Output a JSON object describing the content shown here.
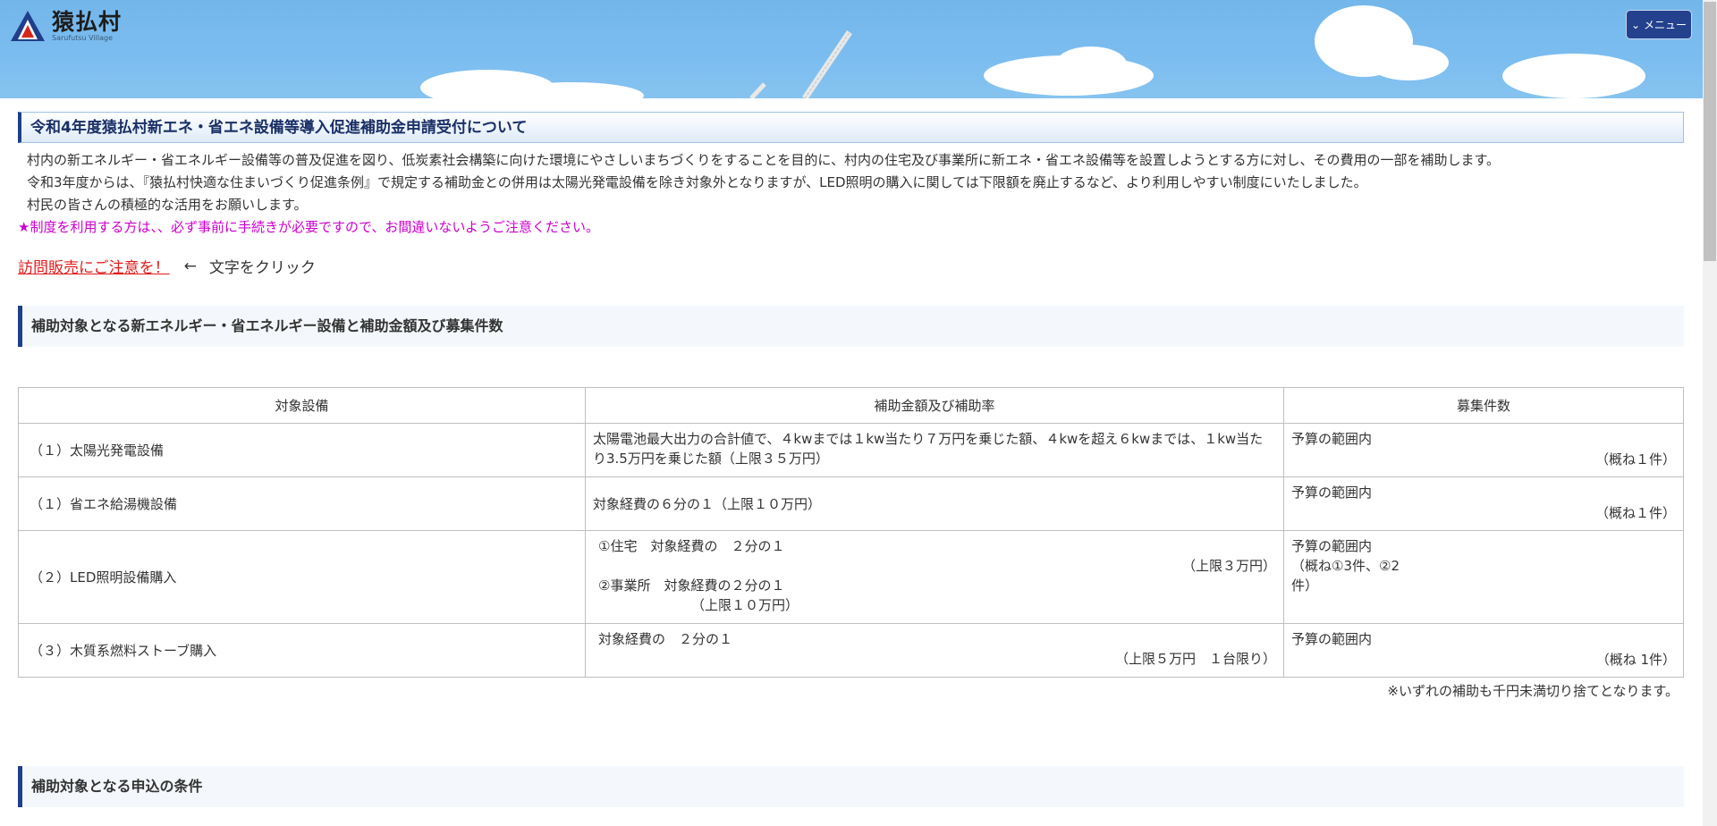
{
  "header": {
    "logo_title": "猿払村",
    "logo_sub": "Sarufutsu Village",
    "menu_label": "メニュー"
  },
  "page": {
    "title": "令和4年度猿払村新エネ・省エネ設備等導入促進補助金申請受付について",
    "intro": [
      "村内の新エネルギー・省エネルギー設備等の普及促進を図り、低炭素社会構築に向けた環境にやさしいまちづくりをすることを目的に、村内の住宅及び事業所に新エネ・省エネ設備等を設置しようとする方に対し、その費用の一部を補助します。",
      "令和3年度からは、『猿払村快適な住まいづくり促進条例』で規定する補助金との併用は太陽光発電設備を除き対象外となりますが、LED照明の購入に関しては下限額を廃止するなど、より利用しやすい制度にいたしました。",
      "村民の皆さんの積極的な活用をお願いします。"
    ],
    "notice": "★制度を利用する方は、、必ず事前に手続きが必要ですので、お間違いないようご注意ください。",
    "visit_link": "訪問販売にご注意を！",
    "arrow": "←",
    "click_hint": "文字をクリック"
  },
  "section1": {
    "heading": "補助対象となる新エネルギー・省エネルギー設備と補助金額及び募集件数"
  },
  "table": {
    "headers": [
      "対象設備",
      "補助金額及び補助率",
      "募集件数"
    ],
    "rows": [
      {
        "item": "（１）太陽光発電設備",
        "amount_lines": [
          "太陽電池最大出力の合計値で、４kwまでは１kw当たり７万円を乗じた額、４kwを超え６kwまでは、１kw当たり3.5万円を乗じた額（上限３５万円）"
        ],
        "recruit": "予算の範囲内",
        "recruit_count": "（概ね１件）"
      },
      {
        "item": "（１）省エネ給湯機設備",
        "amount_lines": [
          "対象経費の６分の１（上限１０万円）"
        ],
        "recruit": "予算の範囲内",
        "recruit_count": "（概ね１件）"
      },
      {
        "item": "（２）LED照明設備購入",
        "amount_a": "①住宅　対象経費の　２分の１",
        "amount_a_limit": "（上限３万円）",
        "amount_b": "②事業所　対象経費の２分の１",
        "amount_b_limit": "（上限１０万円）",
        "recruit": "予算の範囲内",
        "recruit_count_a": "（概ね①3件、②2",
        "recruit_count_b": "件）"
      },
      {
        "item": "（３）木質系燃料ストーブ購入",
        "amount_a": "対象経費の　２分の１",
        "amount_a_limit": "（上限５万円　１台限り）",
        "recruit": "予算の範囲内",
        "recruit_count": "（概ね 1件）"
      }
    ],
    "note": "※いずれの補助も千円未満切り捨てとなります。"
  },
  "section2": {
    "heading": "補助対象となる申込の条件"
  },
  "colors": {
    "header_sky": "#7cbdf0",
    "accent_navy": "#1f3f8a",
    "notice_magenta": "#cc00cc",
    "link_red": "#e01b1b"
  }
}
